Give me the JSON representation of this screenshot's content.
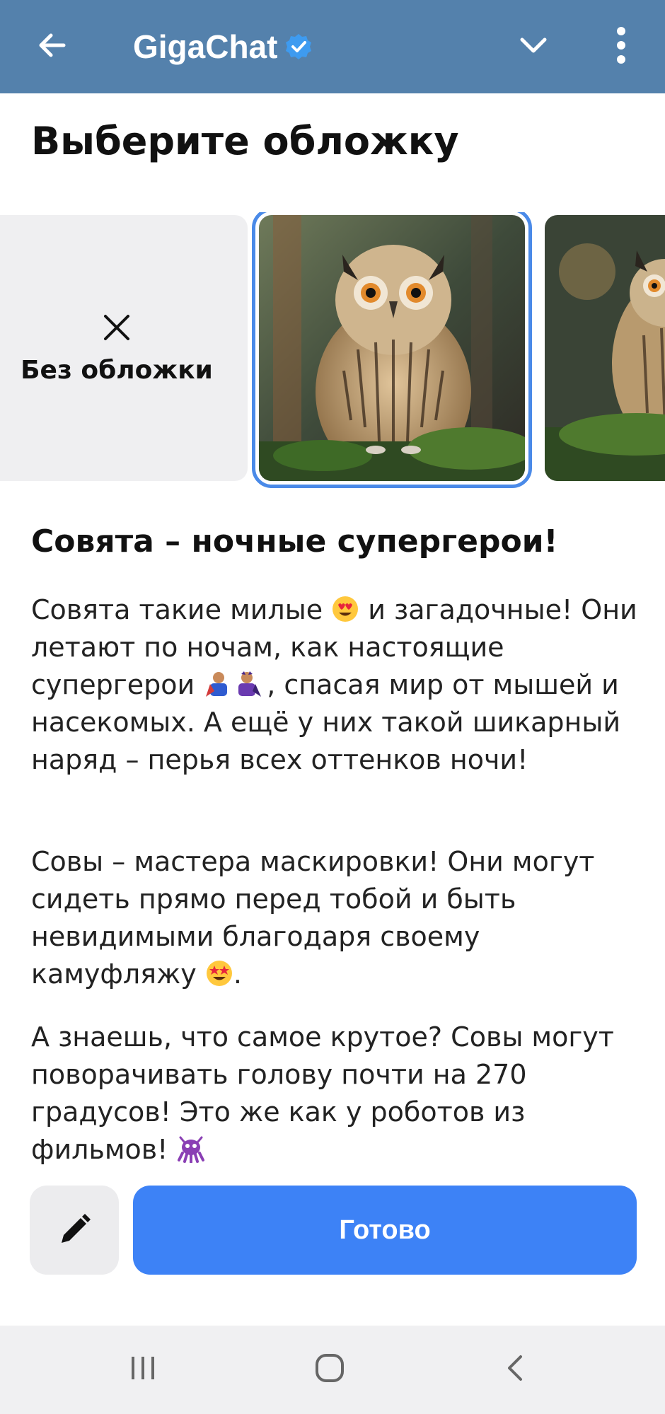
{
  "app": {
    "title": "GigaChat",
    "verified_icon": "verified-badge-icon",
    "back_icon": "arrow-left-icon",
    "chevron_icon": "chevron-down-icon",
    "more_icon": "more-vertical-icon",
    "bar_color": "#5481AC"
  },
  "sheet": {
    "title": "Выберите обложку",
    "no_cover_label": "Без обложки",
    "no_cover_icon": "close-icon",
    "selected_color": "#4A8AE8",
    "covers": [
      {
        "name": "owl-cover-1",
        "selected": true
      },
      {
        "name": "owl-cover-2",
        "selected": false
      }
    ]
  },
  "post": {
    "title": "Совята – ночные супергерои!",
    "p1_a": "Совята такие милые ",
    "p1_b": " и загадочные! Они летают по ночам, как настоящие супергерои ",
    "p1_c": ", спасая мир от мышей и насекомых. А ещё у них такой шикарный наряд – перья всех оттенков ночи!",
    "p2_a": "Совы – мастера маскировки! Они могут сидеть прямо перед тобой и быть невидимыми благодаря своему камуфляжу ",
    "p2_b": ".",
    "p3_a": "А знаешь, что самое крутое? Совы могут поворачивать голову почти на 270 градусов! Это же как у роботов из фильмов! ",
    "emojis": [
      "heart-eyes-emoji",
      "superhero-emoji",
      "supervillain-emoji",
      "star-struck-emoji",
      "alien-monster-emoji"
    ]
  },
  "actions": {
    "edit_icon": "pencil-icon",
    "done_label": "Готово",
    "done_color": "#3D82F6"
  },
  "navbar": {
    "recents_icon": "recents-icon",
    "home_icon": "home-icon",
    "back_icon": "back-chevron-icon"
  }
}
